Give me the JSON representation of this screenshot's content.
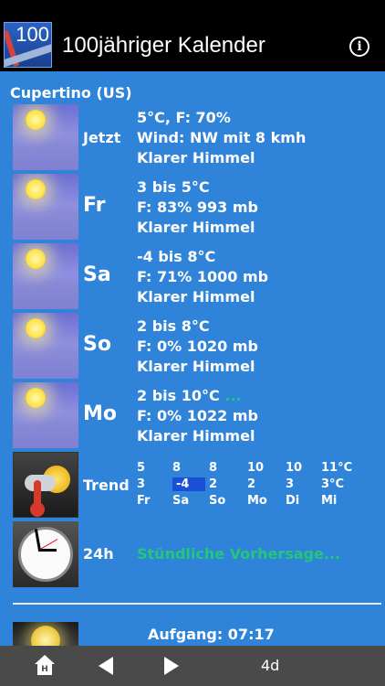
{
  "header": {
    "icon_text": "100",
    "title": "100jähriger Kalender",
    "info_glyph": "i"
  },
  "location": "Cupertino (US)",
  "forecast": [
    {
      "day": "Jetzt",
      "line1": "5°C, F: 70%",
      "line2": "Wind: NW mit 8 kmh",
      "line3": "Klarer Himmel"
    },
    {
      "day": "Fr",
      "line1": "3 bis 5°C",
      "line2": "F: 83% 993 mb",
      "line3": "Klarer Himmel"
    },
    {
      "day": "Sa",
      "line1": "-4 bis 8°C",
      "line2": "F: 71% 1000 mb",
      "line3": "Klarer Himmel"
    },
    {
      "day": "So",
      "line1": "2 bis 8°C",
      "line2": "F: 0% 1020 mb",
      "line3": "Klarer Himmel"
    },
    {
      "day": "Mo",
      "line1": "2 bis 10°C",
      "line1_more": "...",
      "line2": "F: 0% 1022 mb",
      "line3": "Klarer Himmel"
    }
  ],
  "trend": {
    "label": "Trend",
    "highs": [
      "5",
      "8",
      "8",
      "10",
      "10",
      "11°C"
    ],
    "lows": [
      "3",
      "-4",
      "2",
      "2",
      "3",
      "3°C"
    ],
    "days": [
      "Fr",
      "Sa",
      "So",
      "Mo",
      "Di",
      "Mi"
    ]
  },
  "hourly": {
    "label": "24h",
    "link": "Stündliche Vorhersage..."
  },
  "sun": {
    "sunrise": "Aufgang: 07:17"
  },
  "toolbar": {
    "home_glyph": "H",
    "period": "4d"
  },
  "colors": {
    "background": "#2f83d9",
    "accent_green": "#22c77a",
    "highlight": "#1a4fd8"
  }
}
